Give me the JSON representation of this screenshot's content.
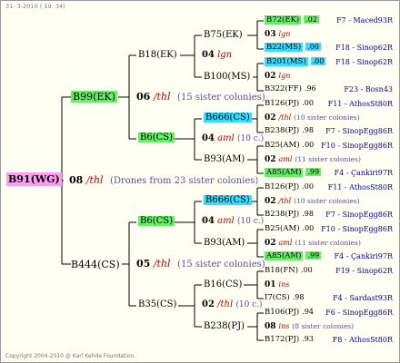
{
  "header": {
    "text": "31-  3-2010 ( 19: 34)"
  },
  "footer": {
    "text": "Copyright 2004-2010 @ Karl Kehde Foundation."
  },
  "root": {
    "label": "B91(WG)"
  },
  "mid": {
    "gen": "08",
    "lbl": "/thl",
    "note": "(Drones from 23 sister colonies)"
  },
  "b99": {
    "label": "B99(EK)"
  },
  "b444": {
    "label": "B444(CS)"
  },
  "a": {
    "g06": "06",
    "lbl06": "/thl",
    "note06": "(15 sister colonies)",
    "b18": "B18(EK)",
    "b6": "B6(CS)",
    "g04a": "04",
    "lbl04a": "lgn",
    "g04b": "04",
    "lbl04b": "aml",
    "note04b": "(10 c.)",
    "b75": "B75(EK)",
    "b100": "B100(MS)",
    "b666": "B666(CS)",
    "b93": "B93(AM)"
  },
  "b": {
    "g05": "05",
    "lbl05": "/thl",
    "note05": "(15 sister colonies)",
    "b6": "B6(CS)",
    "b35": "B35(CS)",
    "g04": "04",
    "lbl04": "aml",
    "note04": "(10 c.)",
    "g02": "02",
    "lbl02": "/thl",
    "note02": "(10 c.)",
    "b666": "B666(CS)",
    "b93": "B93(AM)",
    "b16": "B16(CS)",
    "b238": "B238(PJ)"
  },
  "leaves": [
    {
      "name": "B72(EK)",
      "num": ".02",
      "right": "F7 - Maced93R"
    },
    {
      "name": "03",
      "lbl": "lgn",
      "right": ""
    },
    {
      "name": "B22(MS)",
      "num": ".00",
      "right": "F18 - Sinop62R"
    },
    {
      "name": "B201(MS)",
      "num": ".00",
      "right": "F18 - Sinop62R"
    },
    {
      "name": "02",
      "lbl": "lgn",
      "right": ""
    },
    {
      "name": "B322(FF)",
      "num": ".96",
      "right": "F23 - Bosn43"
    },
    {
      "name": "B126(PJ)",
      "num": ".00",
      "right": "F11 - AthosSt80R"
    },
    {
      "name": "02",
      "lbl": "/thl",
      "note": "(10 sister colonies)",
      "right": ""
    },
    {
      "name": "B238(PJ)",
      "num": ".98",
      "right": "F7 - SinopEgg86R"
    },
    {
      "name": "B25(AM)",
      "num": ".00",
      "right": "F10 - SinopEgg86R"
    },
    {
      "name": "02",
      "lbl": "aml",
      "note": "(11 sister colonies)",
      "right": ""
    },
    {
      "name": "A85(AM)",
      "num": ".99",
      "right": "F4 - Çankiri97R"
    },
    {
      "name": "B126(PJ)",
      "num": ".00",
      "right": "F11 - AthosSt80R"
    },
    {
      "name": "02",
      "lbl": "/thl",
      "note": "(10 sister colonies)",
      "right": ""
    },
    {
      "name": "B238(PJ)",
      "num": ".98",
      "right": "F7 - SinopEgg86R"
    },
    {
      "name": "B25(AM)",
      "num": ".00",
      "right": "F10 - SinopEgg86R"
    },
    {
      "name": "02",
      "lbl": "aml",
      "note": "(11 sister colonies)",
      "right": ""
    },
    {
      "name": "A85(AM)",
      "num": ".99",
      "right": "F4 - Çankiri97R"
    },
    {
      "name": "B18(FN)",
      "num": ".00",
      "right": "F19 - Sinop62R"
    },
    {
      "name": "01",
      "lbl": "ins",
      "right": ""
    },
    {
      "name": "I7(CS)",
      "num": ".98",
      "right": "F4 - Sardast93R"
    },
    {
      "name": "B106(PJ)",
      "num": ".94",
      "right": "F6 - SinopEgg86R"
    },
    {
      "name": "08",
      "lbl": "ins",
      "note": "(8 sister colonies)",
      "right": ""
    },
    {
      "name": "B172(PJ)",
      "num": ".93",
      "right": "F8 - AthosSt80R"
    }
  ]
}
